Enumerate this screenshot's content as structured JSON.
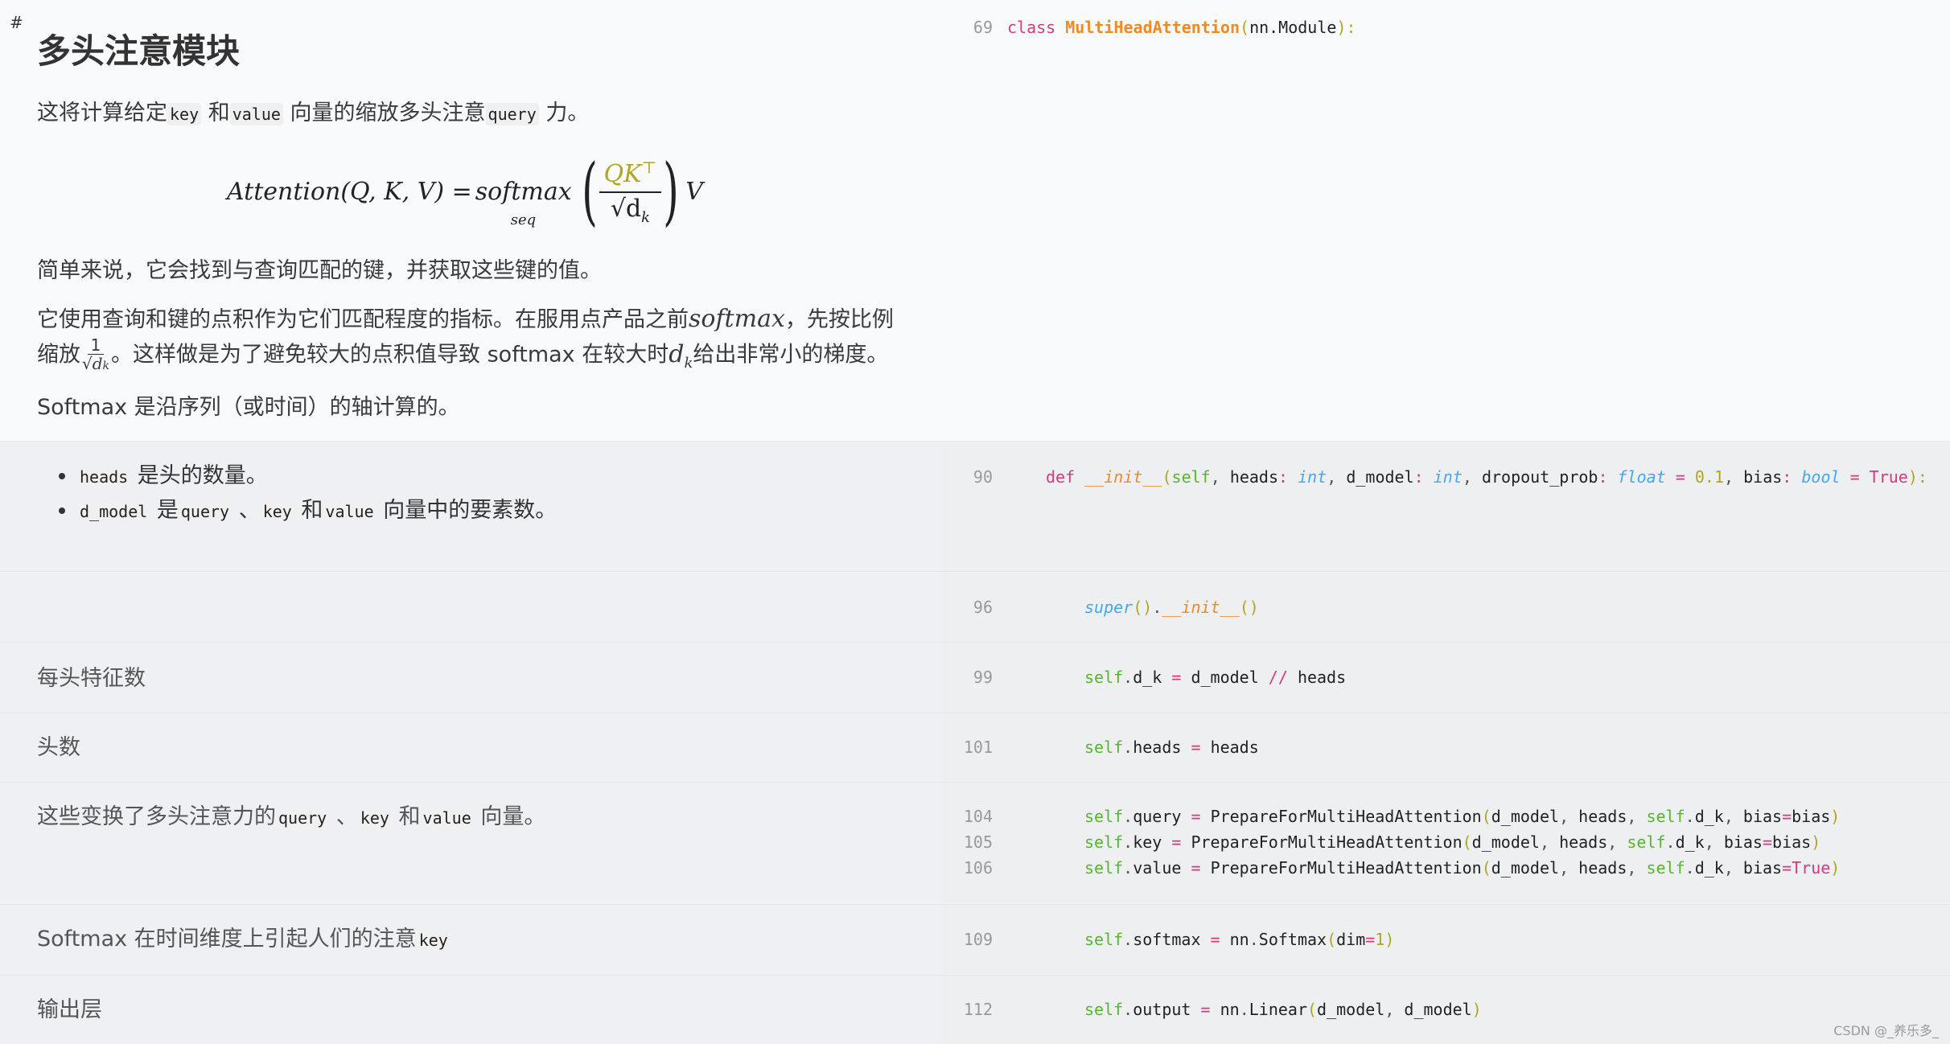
{
  "section": {
    "anchor": "#",
    "title": "多头注意模块",
    "intro": {
      "t1": "这将计算给定",
      "c1": "key",
      "t2": " 和",
      "c2": "value",
      "t3": " 向量的缩放多头注意",
      "c3": "query",
      "t4": " 力。"
    },
    "equation": {
      "lhs": "Attention(Q, K, V) = ",
      "softmax": "softmax",
      "subscript": "seq",
      "numerator": "QK",
      "numerator_sup": "⊤",
      "denominator": "√d",
      "denominator_sub": "k",
      "rhs": "V"
    },
    "p2": "简单来说，它会找到与查询匹配的键，并获取这些键的值。",
    "p3": {
      "t1": "它使用查询和键的点积作为它们匹配程度的指标。在服用点产品之前",
      "m1": "softmax",
      "t2": "，先按比例"
    },
    "p4": {
      "t1": "缩放",
      "frac_num": "1",
      "frac_den": "√d",
      "frac_den_sub": "k",
      "t2": "。这样做是为了避免较大的点积值导致 softmax 在较大时",
      "m1": "d",
      "m1_sub": "k",
      "t3": "给出非常小的梯度。"
    },
    "p5": "Softmax 是沿序列（或时间）的轴计算的。"
  },
  "header_code": {
    "line_no": "69",
    "kw": "class",
    "name": "MultiHeadAttention",
    "lp": "(",
    "base": "nn.Module",
    "rp": "):"
  },
  "rows": [
    {
      "bullets": [
        {
          "code": "heads",
          "text": " 是头的数量。"
        },
        {
          "code": "d_model",
          "text_a": " 是",
          "code_b": "query",
          "text_b": " 、",
          "code_c": "key",
          "text_c": " 和",
          "code_d": "value",
          "text_d": " 向量中的要素数。"
        }
      ],
      "line_no": "90"
    },
    {
      "note": "",
      "line_no": "96"
    },
    {
      "note": "每头特征数",
      "line_no": "99"
    },
    {
      "note": "头数",
      "line_no": "101"
    },
    {
      "note_parts": {
        "t1": "这些变换了多头注意力的",
        "c1": "query",
        "t2": " 、",
        "c2": "key",
        "t3": " 和",
        "c3": "value",
        "t4": " 向量。"
      },
      "line_nos": [
        "104",
        "105",
        "106"
      ]
    },
    {
      "note_parts": {
        "t1": "Softmax 在时间维度上引起人们的注意",
        "c1": "key"
      },
      "line_no": "109"
    },
    {
      "note": "输出层",
      "line_no": "112"
    }
  ],
  "code_tokens": {
    "def": "def",
    "init": "__init__",
    "self": "self",
    "heads": "heads",
    "int": "int",
    "d_model": "d_model",
    "dropout_prob": "dropout_prob",
    "float": "float",
    "v01": "0.1",
    "bias": "bias",
    "bool": "bool",
    "true": "True",
    "super": "super",
    "d_k": "d_k",
    "query": "query",
    "key": "key",
    "value": "value",
    "prep": "PrepareForMultiHeadAttention",
    "softmax": "softmax",
    "nn": "nn",
    "Softmax": "Softmax",
    "dim": "dim",
    "one": "1",
    "output": "output",
    "Linear": "Linear"
  },
  "watermark": "CSDN @_养乐多_"
}
